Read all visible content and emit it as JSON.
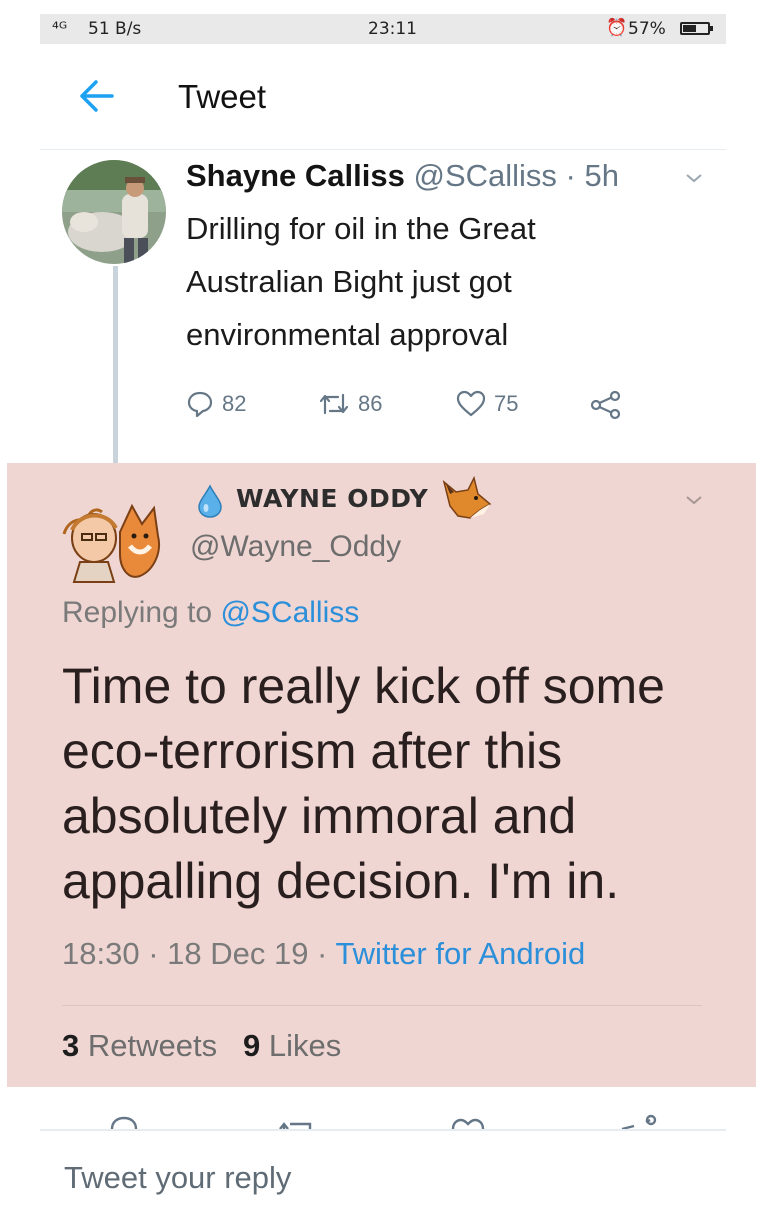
{
  "status_bar": {
    "signal": "⁴ᴳ",
    "speed": "51 B/s",
    "time": "23:11",
    "battery_percent": "57%",
    "battery_level": 0.57
  },
  "header": {
    "title": "Tweet",
    "back_icon": "back-arrow-icon"
  },
  "parent_tweet": {
    "display_name": "Shayne Calliss",
    "handle": "@SCalliss",
    "separator": "·",
    "age": "5h",
    "text": "Drilling for oil in the Great Australian Bight just got environmental approval",
    "replies": "82",
    "retweets": "86",
    "likes": "75"
  },
  "reply_tweet": {
    "display_name": "WAYNE ODDY",
    "handle": "@Wayne_Oddy",
    "replying_prefix": "Replying to",
    "replying_to": "@SCalliss",
    "text": "Time to really kick off some eco-terrorism after this absolutely immoral and appalling decision.  I'm in.",
    "timestamp": "18:30 · 18 Dec 19 · ",
    "source": "Twitter for Android",
    "retweet_count": "3",
    "retweet_label": "Retweets",
    "like_count": "9",
    "like_label": "Likes",
    "background": "#efd6d2"
  },
  "reply_box": {
    "placeholder": "Tweet your reply"
  },
  "colors": {
    "accent": "#1da1f2",
    "link": "#2c8fd9",
    "muted": "#657786"
  }
}
